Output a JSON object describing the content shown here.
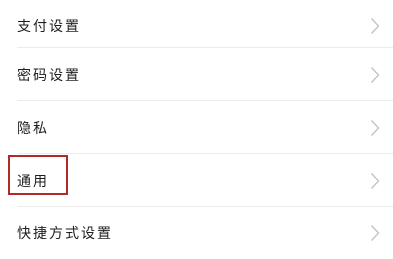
{
  "settings": {
    "items": [
      {
        "label": "支付设置",
        "icon": "chevron-right-icon"
      },
      {
        "label": "密码设置",
        "icon": "chevron-right-icon"
      },
      {
        "label": "隐私",
        "icon": "chevron-right-icon"
      },
      {
        "label": "通用",
        "icon": "chevron-right-icon",
        "highlighted": true
      },
      {
        "label": "快捷方式设置",
        "icon": "chevron-right-icon"
      }
    ]
  },
  "colors": {
    "highlight_border": "#b02a2a",
    "divider": "#ebebeb",
    "chevron": "#c4c4c4",
    "text": "#1e1e1e"
  }
}
